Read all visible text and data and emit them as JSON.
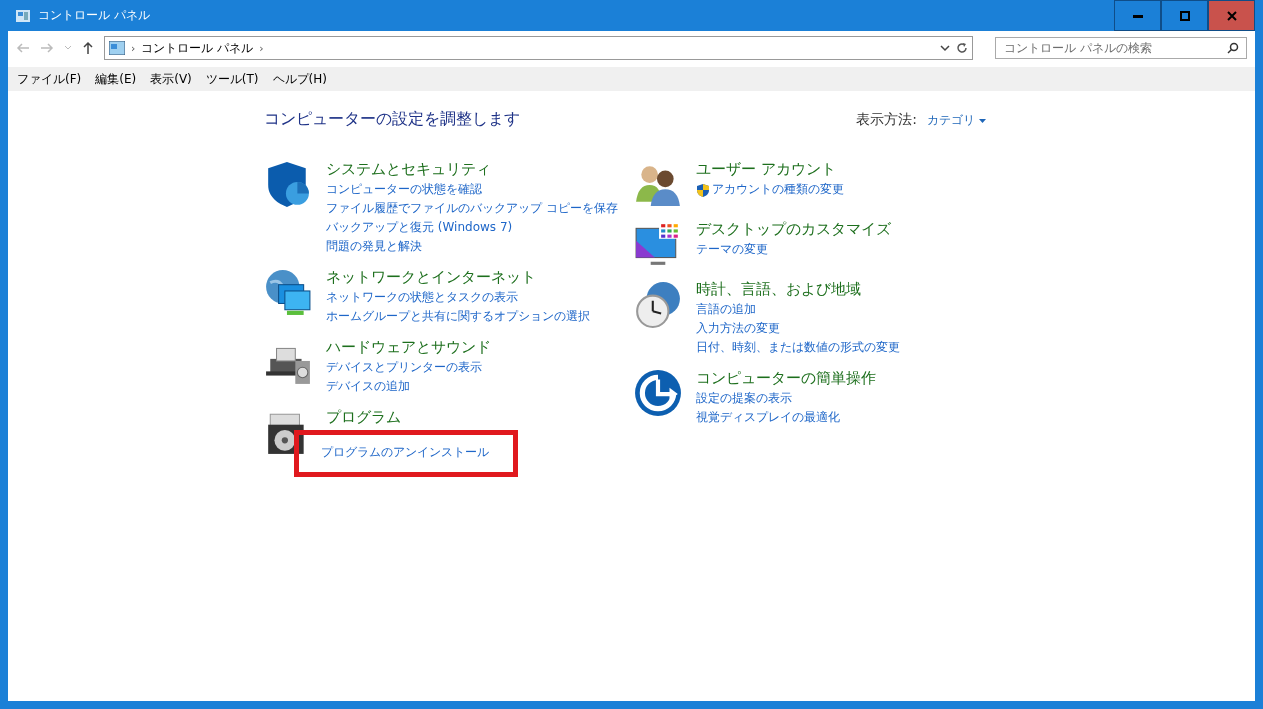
{
  "window": {
    "title": "コントロール パネル"
  },
  "address_bar": {
    "path": [
      "›",
      "コントロール パネル",
      "›"
    ]
  },
  "search": {
    "placeholder": "コントロール パネルの検索"
  },
  "menu": [
    "ファイル(F)",
    "編集(E)",
    "表示(V)",
    "ツール(T)",
    "ヘルプ(H)"
  ],
  "heading": "コンピューターの設定を調整します",
  "view_by": {
    "label": "表示方法:",
    "value": "カテゴリ"
  },
  "left_column": [
    {
      "kind": "security",
      "title": "システムとセキュリティ",
      "links": [
        {
          "text": "コンピューターの状態を確認",
          "shield": false,
          "highlighted": false
        },
        {
          "text": "ファイル履歴でファイルのバックアップ コピーを保存",
          "shield": false,
          "highlighted": false
        },
        {
          "text": "バックアップと復元 (Windows 7)",
          "shield": false,
          "highlighted": false
        },
        {
          "text": "問題の発見と解決",
          "shield": false,
          "highlighted": false
        }
      ]
    },
    {
      "kind": "network",
      "title": "ネットワークとインターネット",
      "links": [
        {
          "text": "ネットワークの状態とタスクの表示",
          "shield": false,
          "highlighted": false
        },
        {
          "text": "ホームグループと共有に関するオプションの選択",
          "shield": false,
          "highlighted": false
        }
      ]
    },
    {
      "kind": "hardware",
      "title": "ハードウェアとサウンド",
      "links": [
        {
          "text": "デバイスとプリンターの表示",
          "shield": false,
          "highlighted": false
        },
        {
          "text": "デバイスの追加",
          "shield": false,
          "highlighted": false
        }
      ]
    },
    {
      "kind": "programs",
      "title": "プログラム",
      "links": [
        {
          "text": "プログラムのアンインストール",
          "shield": false,
          "highlighted": true
        }
      ]
    }
  ],
  "right_column": [
    {
      "kind": "users",
      "title": "ユーザー アカウント",
      "links": [
        {
          "text": "アカウントの種類の変更",
          "shield": true,
          "highlighted": false
        }
      ]
    },
    {
      "kind": "desktop",
      "title": "デスクトップのカスタマイズ",
      "links": [
        {
          "text": "テーマの変更",
          "shield": false,
          "highlighted": false
        }
      ]
    },
    {
      "kind": "clock",
      "title": "時計、言語、および地域",
      "links": [
        {
          "text": "言語の追加",
          "shield": false,
          "highlighted": false
        },
        {
          "text": "入力方法の変更",
          "shield": false,
          "highlighted": false
        },
        {
          "text": "日付、時刻、または数値の形式の変更",
          "shield": false,
          "highlighted": false
        }
      ]
    },
    {
      "kind": "access",
      "title": "コンピューターの簡単操作",
      "links": [
        {
          "text": "設定の提案の表示",
          "shield": false,
          "highlighted": false
        },
        {
          "text": "視覚ディスプレイの最適化",
          "shield": false,
          "highlighted": false
        }
      ]
    }
  ]
}
